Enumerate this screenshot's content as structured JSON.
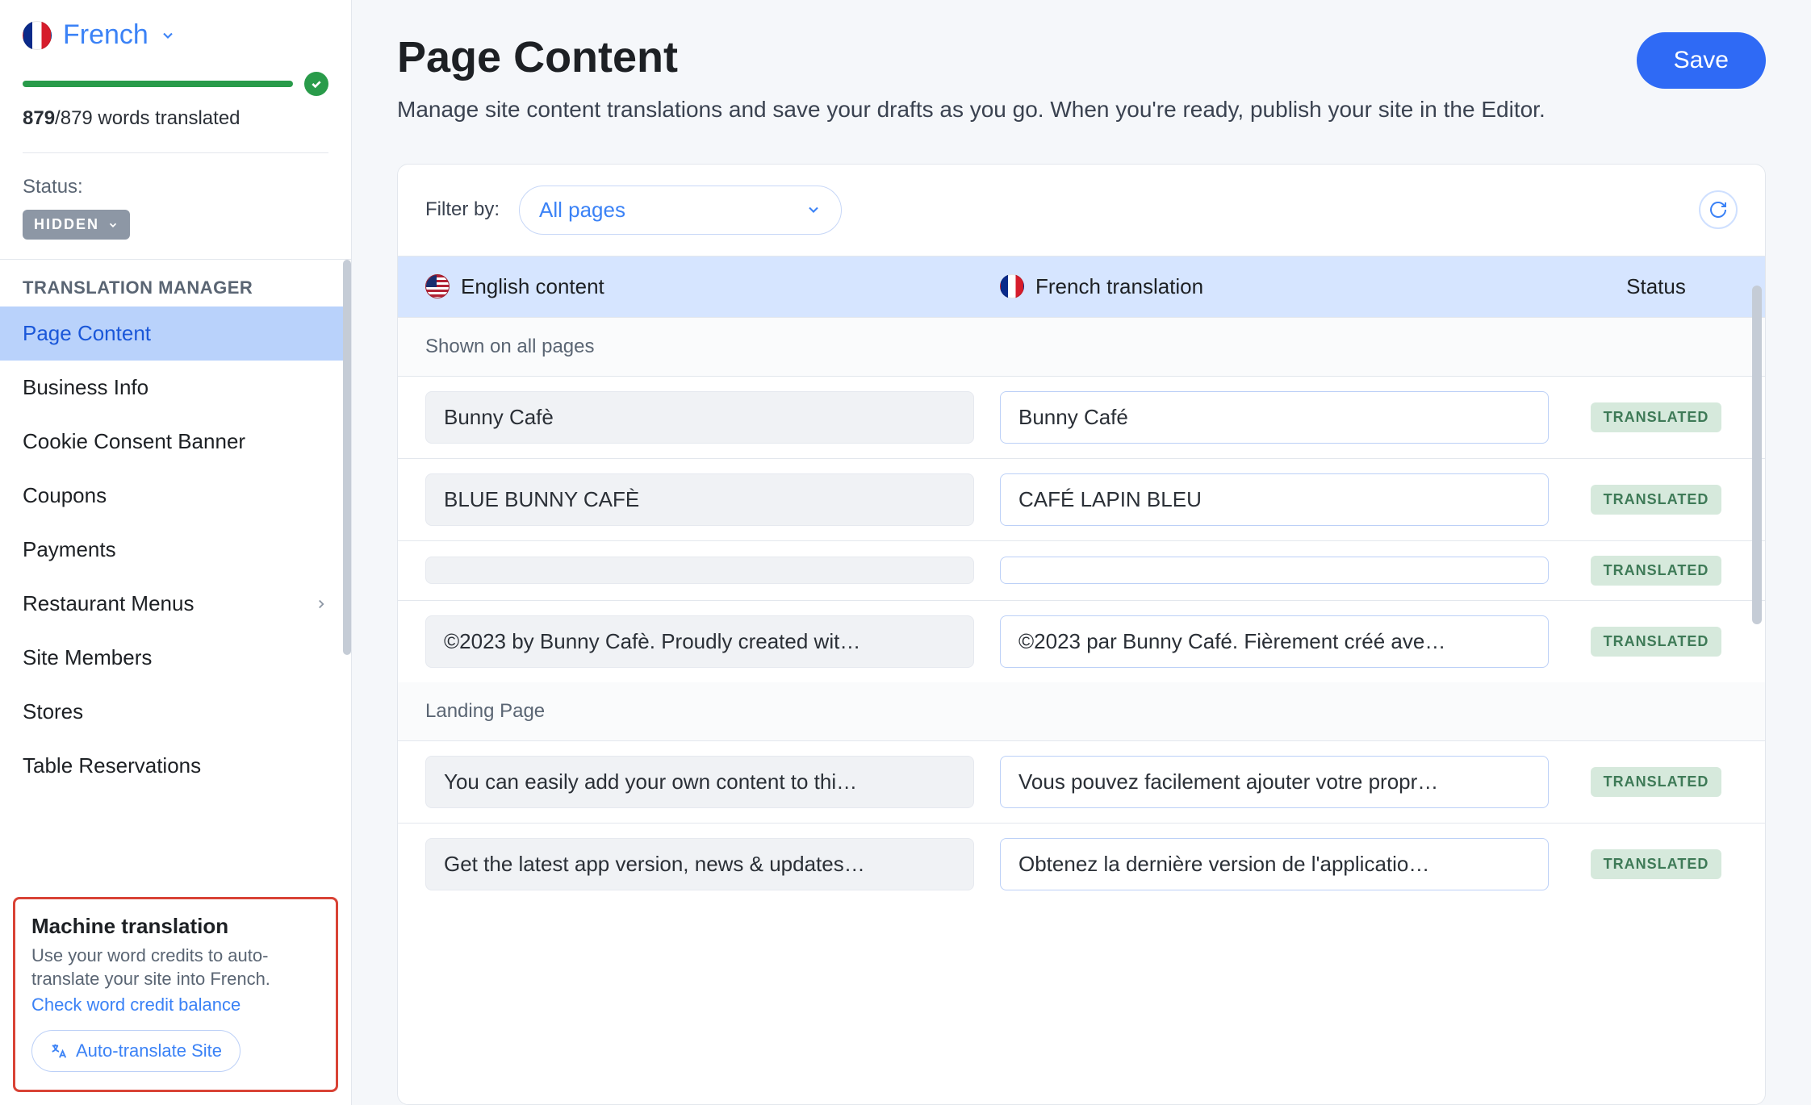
{
  "sidebar": {
    "language": "French",
    "words_done": "879",
    "words_total": "879",
    "words_suffix": " words translated",
    "status_label": "Status:",
    "status_value": "HIDDEN",
    "nav_heading": "TRANSLATION MANAGER",
    "items": [
      {
        "label": "Page Content",
        "active": true
      },
      {
        "label": "Business Info"
      },
      {
        "label": "Cookie Consent Banner"
      },
      {
        "label": "Coupons"
      },
      {
        "label": "Payments"
      },
      {
        "label": "Restaurant Menus",
        "has_children": true
      },
      {
        "label": "Site Members"
      },
      {
        "label": "Stores"
      },
      {
        "label": "Table Reservations"
      }
    ],
    "machine": {
      "title": "Machine translation",
      "desc": "Use your word credits to auto-translate your site into French.",
      "link": "Check word credit balance",
      "button": "Auto-translate Site"
    }
  },
  "main": {
    "title": "Page Content",
    "subtitle": "Manage site content translations and save your drafts as you go. When you're ready, publish your site in the Editor.",
    "save": "Save",
    "filter_label": "Filter by:",
    "filter_value": "All pages",
    "columns": {
      "source": "English content",
      "target": "French translation",
      "status": "Status"
    },
    "sections": [
      {
        "label": "Shown on all pages",
        "rows": [
          {
            "src": "Bunny Cafè",
            "dst": "Bunny Café",
            "status": "TRANSLATED"
          },
          {
            "src": "BLUE BUNNY CAFÈ",
            "dst": "CAFÉ LAPIN BLEU",
            "status": "TRANSLATED"
          },
          {
            "src": "",
            "dst": "",
            "status": "TRANSLATED"
          },
          {
            "src": "©2023 by Bunny Cafè. Proudly created wit…",
            "dst": "©2023 par Bunny Café. Fièrement créé ave…",
            "status": "TRANSLATED"
          }
        ]
      },
      {
        "label": "Landing Page",
        "rows": [
          {
            "src": "You can easily add your own content to thi…",
            "dst": "Vous pouvez facilement ajouter votre propr…",
            "status": "TRANSLATED"
          },
          {
            "src": "Get the latest app version, news & updates…",
            "dst": "Obtenez la dernière version de l'applicatio…",
            "status": "TRANSLATED"
          }
        ]
      }
    ]
  }
}
